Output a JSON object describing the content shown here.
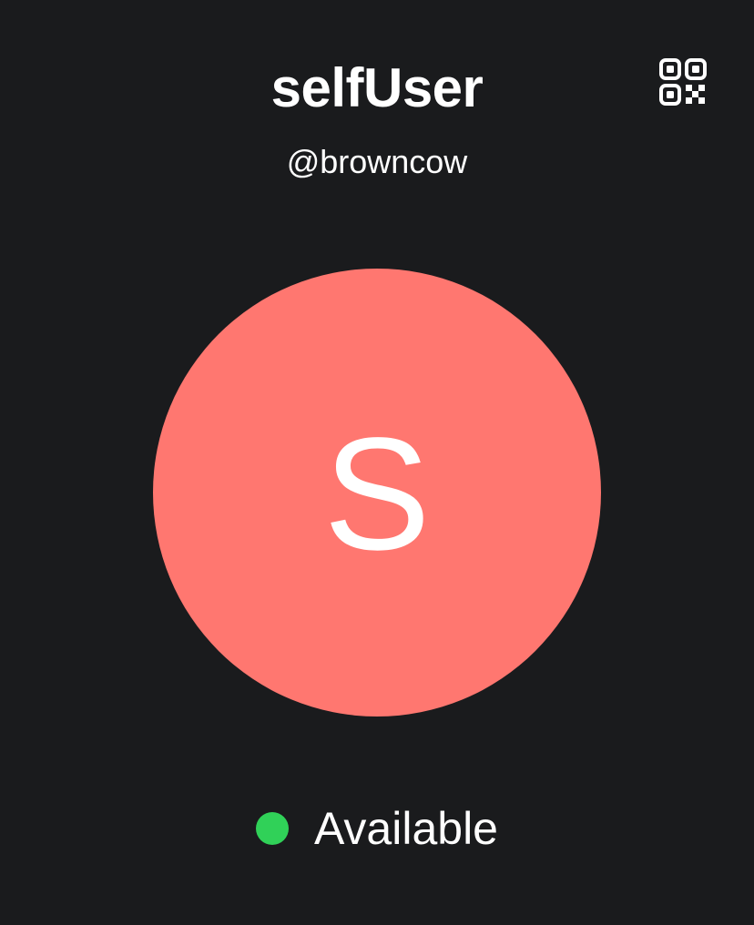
{
  "profile": {
    "name": "selfUser",
    "handle": "@browncow",
    "avatar_initial": "S",
    "avatar_color": "#ff7770"
  },
  "qr": {
    "icon": "qr-code-icon"
  },
  "status": {
    "label": "Available",
    "color": "#30d158"
  },
  "colors": {
    "background": "#1a1b1d",
    "text": "#ffffff"
  }
}
